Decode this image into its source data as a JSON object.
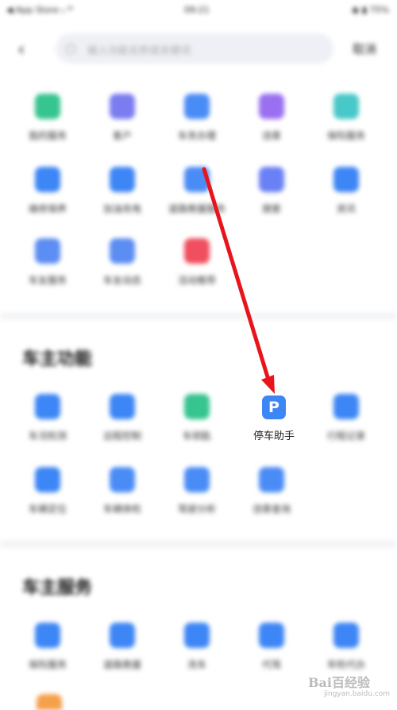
{
  "status_bar": {
    "carrier": "◀ App Store ᵢᵢ ᵂ",
    "time": "09:21",
    "indicators": "◉ ▮ 75%"
  },
  "search": {
    "placeholder": "输入功能名称或关键词",
    "cancel_label": "取消"
  },
  "top_grid": [
    {
      "label": "我的服务",
      "color": "#36c48f",
      "icon": "flag-icon"
    },
    {
      "label": "客户",
      "color": "#7b7cf0",
      "icon": "user-circle-icon"
    },
    {
      "label": "车务办理",
      "color": "#4a8cf6",
      "icon": "mountain-icon"
    },
    {
      "label": "违章",
      "color": "#9a70f0",
      "icon": "document-icon"
    },
    {
      "label": "保险服务",
      "color": "#48c8c8",
      "icon": "house-icon"
    },
    {
      "label": "维修保养",
      "color": "#3d86f5",
      "icon": "cloud-icon"
    },
    {
      "label": "加油充电",
      "color": "#3d86f5",
      "icon": "compass-icon"
    },
    {
      "label": "道路救援服务",
      "color": "#4a8cf6",
      "icon": "mountain-icon"
    },
    {
      "label": "搜索",
      "color": "#6a80f5",
      "icon": "search-icon"
    },
    {
      "label": "资讯",
      "color": "#3d86f5",
      "icon": "folder-icon"
    },
    {
      "label": "车友服务",
      "color": "#5b8df2",
      "icon": "chat-icon"
    },
    {
      "label": "车友动态",
      "color": "#5b8df2",
      "icon": "person-icon"
    },
    {
      "label": "活动推荐",
      "color": "#ef4f5e",
      "icon": "chart-icon"
    }
  ],
  "section1": {
    "title": "车主功能",
    "items": [
      {
        "label": "车况检测",
        "color": "#3d86f5",
        "icon": "car-icon"
      },
      {
        "label": "远程控制",
        "color": "#3d86f5",
        "icon": "panel-icon"
      },
      {
        "label": "车钥匙",
        "color": "#36c48f",
        "icon": "key-icon"
      },
      {
        "label": "行程记录",
        "color": "#3d86f5",
        "icon": "list-icon"
      },
      {
        "label": "车辆定位",
        "color": "#3d86f5",
        "icon": "calendar-icon"
      },
      {
        "label": "车辆体检",
        "color": "#4a8cf6",
        "icon": "shield-icon"
      },
      {
        "label": "驾驶分析",
        "color": "#4a8cf6",
        "icon": "gauge-icon"
      },
      {
        "label": "违章查询",
        "color": "#4a8cf6",
        "icon": "ticket-icon"
      }
    ],
    "parking": {
      "letter": "P",
      "label": "停车助手"
    }
  },
  "section2": {
    "title": "车主服务",
    "items": [
      {
        "label": "保险服务",
        "color": "#3d86f5",
        "icon": "shield-icon"
      },
      {
        "label": "道路救援",
        "color": "#3d86f5",
        "icon": "compass-icon"
      },
      {
        "label": "洗车",
        "color": "#3d86f5",
        "icon": "globe-icon"
      },
      {
        "label": "代驾",
        "color": "#3d86f5",
        "icon": "mountain-icon"
      },
      {
        "label": "年检代办",
        "color": "#3d86f5",
        "icon": "folder-icon"
      }
    ]
  },
  "watermark": {
    "brand": "Bai百经验",
    "url": "jingyan.baidu.com"
  }
}
